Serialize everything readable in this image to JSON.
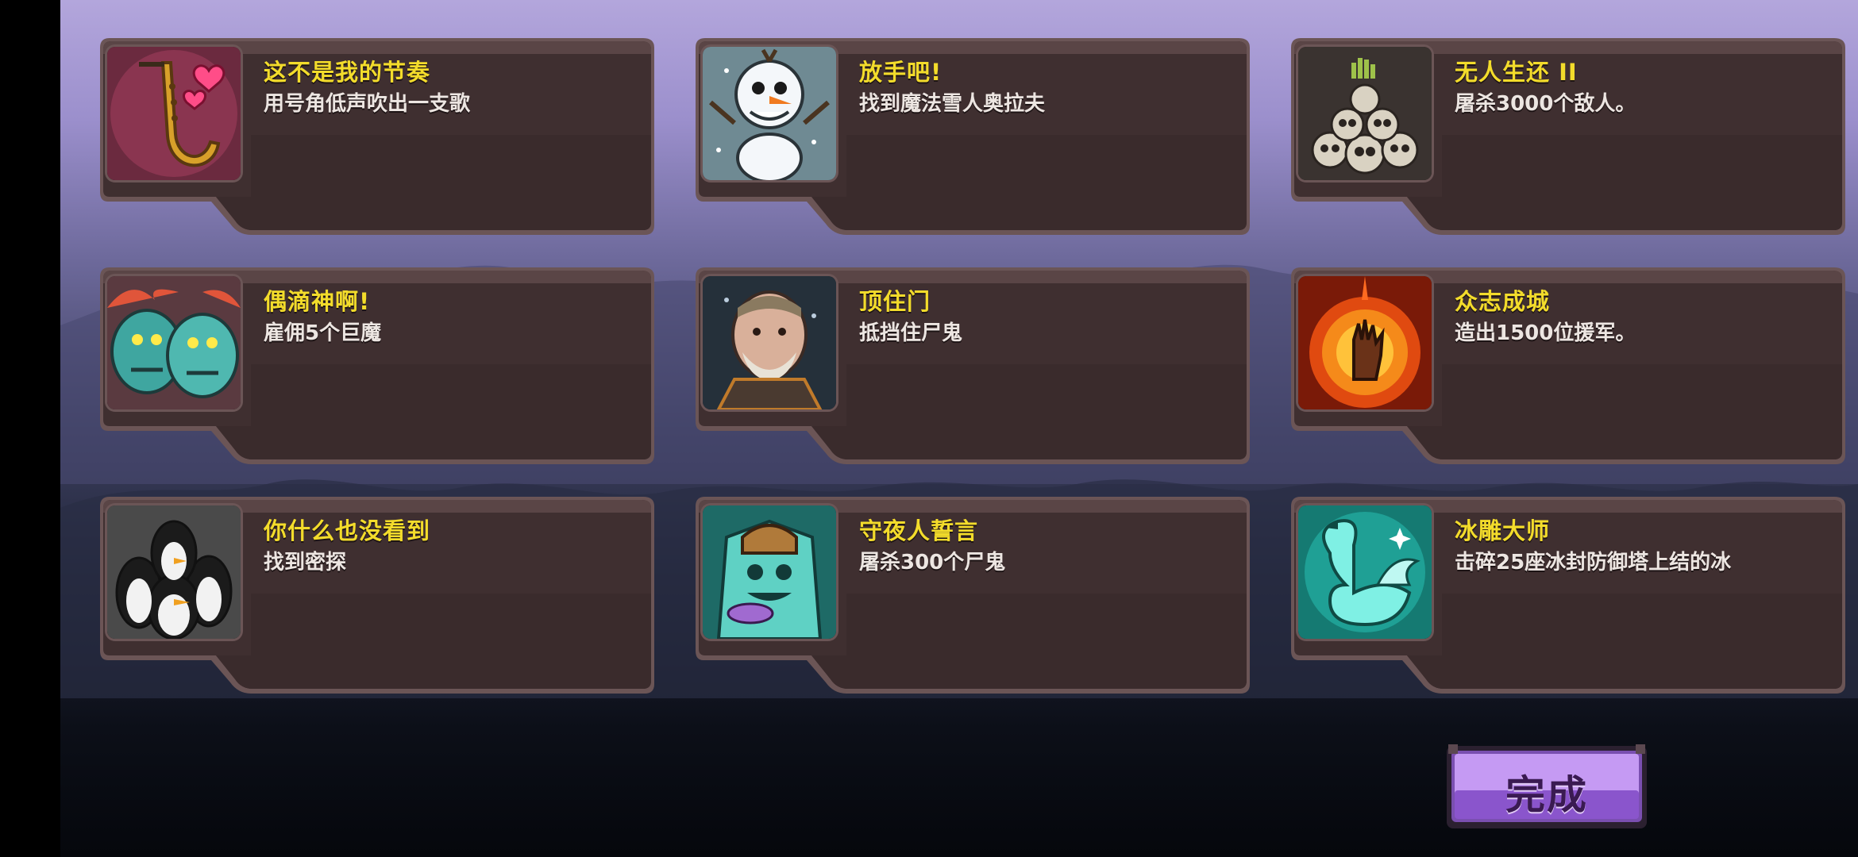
{
  "achievements": [
    {
      "title": "这不是我的节奏",
      "desc": "用号角低声吹出一支歌",
      "icon": "saxophone-hearts-icon"
    },
    {
      "title": "放手吧!",
      "desc": "找到魔法雪人奥拉夫",
      "icon": "snowman-icon"
    },
    {
      "title": "无人生还 II",
      "desc": "屠杀3000个敌人。",
      "icon": "skull-pile-icon"
    },
    {
      "title": "偶滴神啊!",
      "desc": "雇佣5个巨魔",
      "icon": "trolls-icon"
    },
    {
      "title": "顶住门",
      "desc": "抵挡住尸鬼",
      "icon": "bearded-warrior-icon"
    },
    {
      "title": "众志成城",
      "desc": "造出1500位援军。",
      "icon": "fire-hand-icon"
    },
    {
      "title": "你什么也没看到",
      "desc": "找到密探",
      "icon": "penguins-icon"
    },
    {
      "title": "守夜人誓言",
      "desc": "屠杀300个尸鬼",
      "icon": "frozen-ghoul-icon"
    },
    {
      "title": "冰雕大师",
      "desc": "击碎25座冰封防御塔上结的冰",
      "icon": "ice-swan-icon"
    }
  ],
  "done_button": {
    "label": "完成"
  },
  "colors": {
    "title": "#f3dc2b",
    "desc": "#ede6e2",
    "card": "#3f2f30",
    "button": "#9b63d6"
  }
}
